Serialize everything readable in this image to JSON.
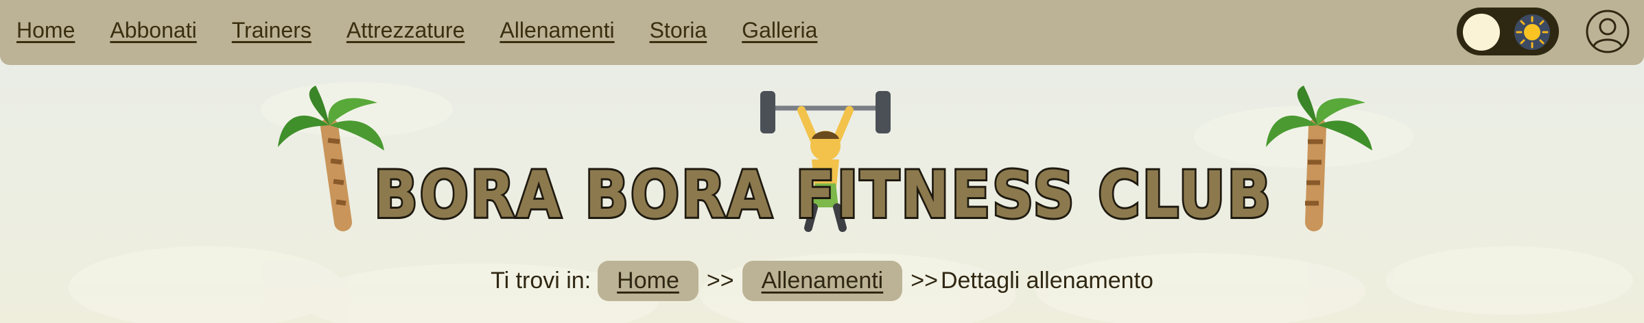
{
  "nav": {
    "links": [
      "Home",
      "Abbonati",
      "Trainers",
      "Attrezzature",
      "Allenamenti",
      "Storia",
      "Galleria"
    ]
  },
  "logo": {
    "text": "BORA BORA FITNESS CLUB"
  },
  "breadcrumb": {
    "prefix": "Ti trovi in:",
    "items": [
      "Home",
      "Allenamenti"
    ],
    "separator": ">>",
    "current": "Dettagli allenamento"
  },
  "colors": {
    "navbar": "#bcb396",
    "toggle_track": "#2e2812",
    "text": "#2f2712",
    "logo_fill": "#8c7a4e"
  },
  "icons": [
    "sun-icon",
    "user-circle-icon",
    "palm-tree-icon",
    "weightlifter-icon"
  ]
}
